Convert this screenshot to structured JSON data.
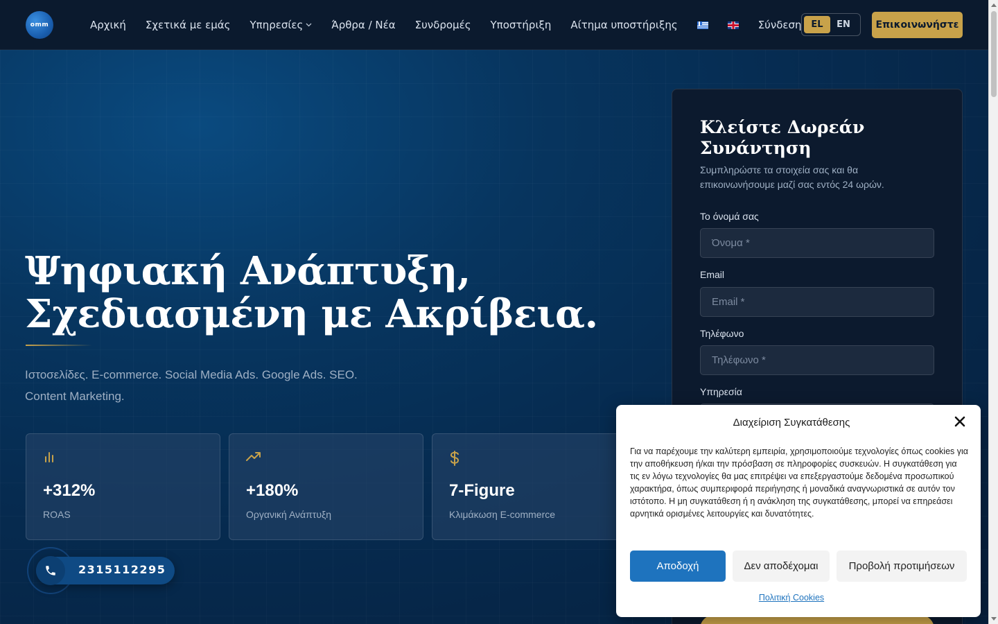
{
  "brand": {
    "logo_text": "omm"
  },
  "nav": {
    "items": [
      {
        "label": "Αρχική"
      },
      {
        "label": "Σχετικά με εμάς"
      },
      {
        "label": "Υπηρεσίες",
        "has_dropdown": true
      },
      {
        "label": "Άρθρα / Νέα"
      },
      {
        "label": "Συνδρομές"
      },
      {
        "label": "Υποστήριξη"
      },
      {
        "label": "Αίτημα υποστήριξης"
      }
    ],
    "flags": [
      "greek-flag-icon",
      "uk-flag-icon"
    ],
    "login_label": "Σύνδεση",
    "lang": {
      "options": [
        "EL",
        "EN"
      ],
      "active": "EL"
    },
    "cta_label": "Επικοινωνήστε"
  },
  "hero": {
    "title_line1": "Ψηφιακή Ανάπτυξη,",
    "title_line2": "Σχεδιασμένη με Ακρίβεια.",
    "subtitle_line1": "Ιστοσελίδες. E-commerce. Social Media Ads. Google Ads. SEO.",
    "subtitle_line2": "Content Marketing.",
    "stats": [
      {
        "icon": "bar-chart-icon",
        "value": "+312%",
        "label": "ROAS"
      },
      {
        "icon": "trending-up-icon",
        "value": "+180%",
        "label": "Οργανική Ανάπτυξη"
      },
      {
        "icon": "dollar-icon",
        "value": "7-Figure",
        "label": "Κλιμάκωση E-commerce"
      }
    ]
  },
  "phone": {
    "number": "2315112295",
    "icon": "phone-icon"
  },
  "form": {
    "title_line1": "Κλείστε Δωρεάν",
    "title_line2": "Συνάντηση",
    "description": "Συμπληρώστε τα στοιχεία σας και θα επικοινωνήσουμε μαζί σας εντός 24 ωρών.",
    "fields": [
      {
        "label": "Το όνομά σας",
        "placeholder": "Όνομα *",
        "value": ""
      },
      {
        "label": "Email",
        "placeholder": "Email *",
        "value": ""
      },
      {
        "label": "Τηλέφωνο",
        "placeholder": "Τηλέφωνο *",
        "value": ""
      },
      {
        "label": "Υπηρεσία"
      }
    ]
  },
  "cookie": {
    "title": "Διαχείριση Συγκατάθεσης",
    "text": "Για να παρέχουμε την καλύτερη εμπειρία, χρησιμοποιούμε τεχνολογίες όπως cookies για την αποθήκευση ή/και την πρόσβαση σε πληροφορίες συσκευών. Η συγκατάθεση για τις εν λόγω τεχνολογίες θα μας επιτρέψει να επεξεργαστούμε δεδομένα προσωπικού χαρακτήρα, όπως συμπεριφορά περιήγησης ή μοναδικά αναγνωριστικά σε αυτόν τον ιστότοπο. Η μη συγκατάθεση ή η ανάκληση της συγκατάθεσης, μπορεί να επηρεάσει αρνητικά ορισμένες λειτουργίες και δυνατότητες.",
    "accept_label": "Αποδοχή",
    "deny_label": "Δεν αποδέχομαι",
    "prefs_label": "Προβολή προτιμήσεων",
    "policy_link": "Πολιτική Cookies"
  },
  "colors": {
    "accent_gold": "#c8a24a",
    "header_bg": "#0b1a2e",
    "accept_blue": "#1e73be"
  }
}
